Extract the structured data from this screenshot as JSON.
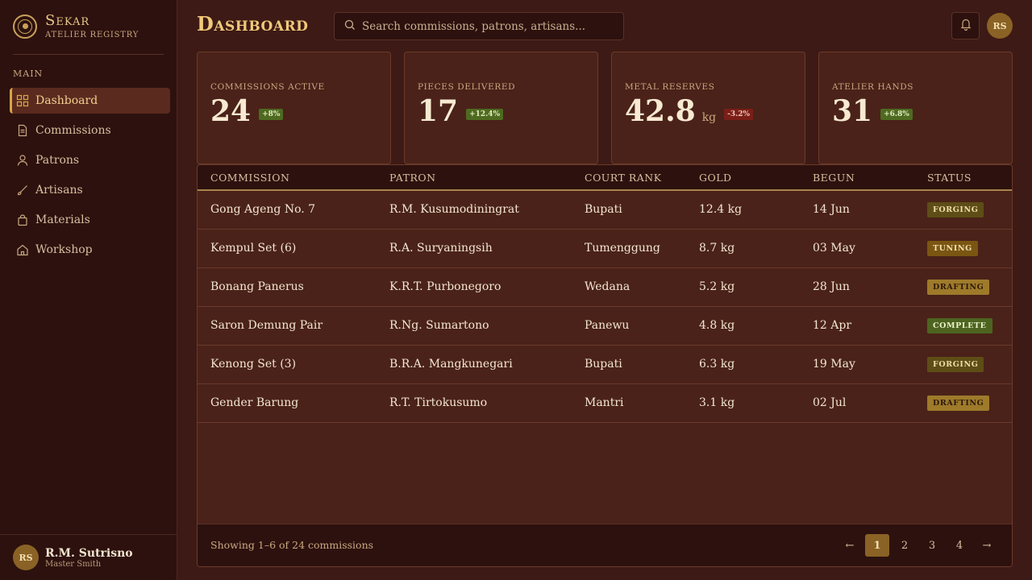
{
  "brand": {
    "title": "Sekar",
    "subtitle": "Atelier Registry"
  },
  "sidebar": {
    "section_label": "Main",
    "items": [
      {
        "label": "Dashboard",
        "icon": "grid-icon",
        "active": true
      },
      {
        "label": "Commissions",
        "icon": "document-icon"
      },
      {
        "label": "Patrons",
        "icon": "person-icon"
      },
      {
        "label": "Artisans",
        "icon": "brush-icon"
      },
      {
        "label": "Materials",
        "icon": "bag-icon"
      },
      {
        "label": "Workshop",
        "icon": "home-icon"
      }
    ],
    "user": {
      "initials": "RS",
      "name": "R.M. Sutrisno",
      "role": "Master Smith"
    }
  },
  "header": {
    "title": "Dashboard",
    "search_placeholder": "Search commissions, patrons, artisans...",
    "avatar_initials": "RS"
  },
  "stats": [
    {
      "label": "Commissions Active",
      "value": "24",
      "unit": "",
      "delta": "+8%",
      "trend": "up"
    },
    {
      "label": "Pieces Delivered",
      "value": "17",
      "unit": "",
      "delta": "+12.4%",
      "trend": "up"
    },
    {
      "label": "Metal Reserves",
      "value": "42.8",
      "unit": "kg",
      "delta": "-3.2%",
      "trend": "down"
    },
    {
      "label": "Atelier Hands",
      "value": "31",
      "unit": "",
      "delta": "+6.8%",
      "trend": "up"
    }
  ],
  "table": {
    "columns": [
      "Commission",
      "Patron",
      "Court Rank",
      "Gold",
      "Begun",
      "Status"
    ],
    "rows": [
      {
        "commission": "Gong Ageng No. 7",
        "patron": "R.M. Kusumodiningrat",
        "rank": "Bupati",
        "gold": "12.4 kg",
        "begun": "14 Jun",
        "status": "Forging"
      },
      {
        "commission": "Kempul Set (6)",
        "patron": "R.A. Suryaningsih",
        "rank": "Tumenggung",
        "gold": "8.7 kg",
        "begun": "03 May",
        "status": "Tuning"
      },
      {
        "commission": "Bonang Panerus",
        "patron": "K.R.T. Purbonegoro",
        "rank": "Wedana",
        "gold": "5.2 kg",
        "begun": "28 Jun",
        "status": "Drafting"
      },
      {
        "commission": "Saron Demung Pair",
        "patron": "R.Ng. Sumartono",
        "rank": "Panewu",
        "gold": "4.8 kg",
        "begun": "12 Apr",
        "status": "Complete"
      },
      {
        "commission": "Kenong Set (3)",
        "patron": "B.R.A. Mangkunegari",
        "rank": "Bupati",
        "gold": "6.3 kg",
        "begun": "19 May",
        "status": "Forging"
      },
      {
        "commission": "Gender Barung",
        "patron": "R.T. Tirtokusumo",
        "rank": "Mantri",
        "gold": "3.1 kg",
        "begun": "02 Jul",
        "status": "Drafting"
      }
    ],
    "footer_text": "Showing 1–6 of 24 commissions",
    "pager": {
      "prev": "←",
      "pages": [
        "1",
        "2",
        "3",
        "4"
      ],
      "current": "1",
      "next": "→"
    }
  },
  "colors": {
    "background": "#3d1a15",
    "sidebar": "#2d110e",
    "accent": "#d6a648",
    "card": "#4a2219"
  }
}
